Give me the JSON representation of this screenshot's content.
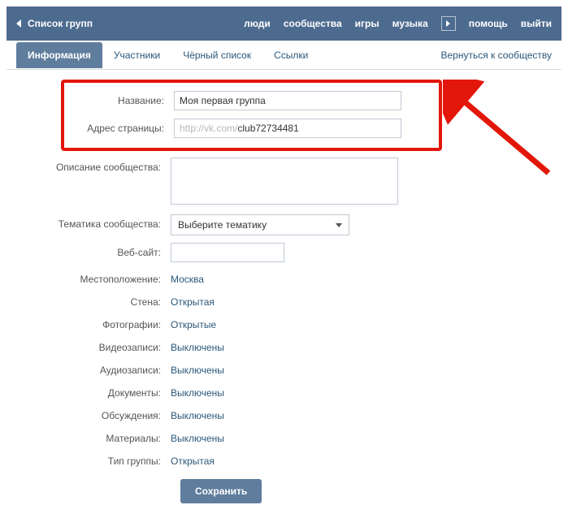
{
  "topbar": {
    "back_label": "Список групп",
    "nav": {
      "people": "люди",
      "communities": "сообщества",
      "games": "игры",
      "music": "музыка",
      "help": "помощь",
      "logout": "выйти"
    }
  },
  "tabs": {
    "info": "Информация",
    "members": "Участники",
    "blacklist": "Чёрный список",
    "links": "Ссылки",
    "return": "Вернуться к сообществу"
  },
  "form": {
    "name_label": "Название:",
    "name_value": "Моя первая группа",
    "address_label": "Адрес страницы:",
    "address_prefix": "http://vk.com/",
    "address_value": "club72734481",
    "desc_label": "Описание сообщества:",
    "desc_value": "",
    "theme_label": "Тематика сообщества:",
    "theme_placeholder": "Выберите тематику",
    "site_label": "Веб-сайт:",
    "site_value": "",
    "settings": [
      {
        "label": "Местоположение:",
        "value": "Москва"
      },
      {
        "label": "Стена:",
        "value": "Открытая"
      },
      {
        "label": "Фотографии:",
        "value": "Открытые"
      },
      {
        "label": "Видеозаписи:",
        "value": "Выключены"
      },
      {
        "label": "Аудиозаписи:",
        "value": "Выключены"
      },
      {
        "label": "Документы:",
        "value": "Выключены"
      },
      {
        "label": "Обсуждения:",
        "value": "Выключены"
      },
      {
        "label": "Материалы:",
        "value": "Выключены"
      },
      {
        "label": "Тип группы:",
        "value": "Открытая"
      }
    ],
    "save": "Сохранить"
  }
}
